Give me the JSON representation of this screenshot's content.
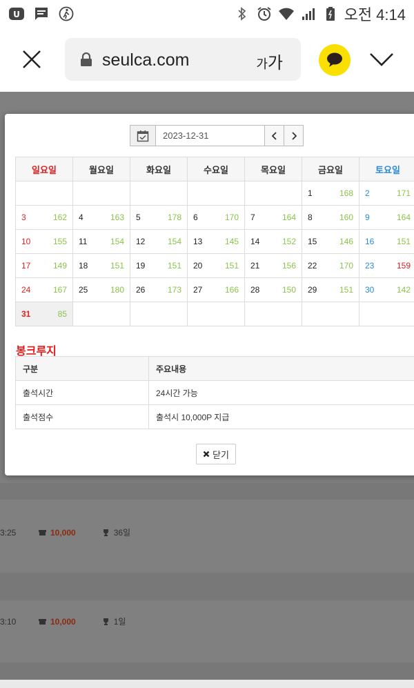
{
  "status_bar": {
    "time": "오전 4:14"
  },
  "browser": {
    "url": "seulca.com",
    "font_size_label_small": "가",
    "font_size_label_large": "가"
  },
  "calendar": {
    "date_value": "2023-12-31",
    "weekdays": [
      "일요일",
      "월요일",
      "화요일",
      "수요일",
      "목요일",
      "금요일",
      "토요일"
    ],
    "weeks": [
      [
        null,
        null,
        null,
        null,
        null,
        {
          "d": "1",
          "n": "168"
        },
        {
          "d": "2",
          "n": "171"
        }
      ],
      [
        {
          "d": "3",
          "n": "162"
        },
        {
          "d": "4",
          "n": "163"
        },
        {
          "d": "5",
          "n": "178"
        },
        {
          "d": "6",
          "n": "170"
        },
        {
          "d": "7",
          "n": "164"
        },
        {
          "d": "8",
          "n": "160"
        },
        {
          "d": "9",
          "n": "164"
        }
      ],
      [
        {
          "d": "10",
          "n": "155"
        },
        {
          "d": "11",
          "n": "154"
        },
        {
          "d": "12",
          "n": "154"
        },
        {
          "d": "13",
          "n": "145"
        },
        {
          "d": "14",
          "n": "152"
        },
        {
          "d": "15",
          "n": "146"
        },
        {
          "d": "16",
          "n": "151"
        }
      ],
      [
        {
          "d": "17",
          "n": "149"
        },
        {
          "d": "18",
          "n": "151"
        },
        {
          "d": "19",
          "n": "151"
        },
        {
          "d": "20",
          "n": "151"
        },
        {
          "d": "21",
          "n": "156"
        },
        {
          "d": "22",
          "n": "170"
        },
        {
          "d": "23",
          "n": "159"
        }
      ],
      [
        {
          "d": "24",
          "n": "167"
        },
        {
          "d": "25",
          "n": "180"
        },
        {
          "d": "26",
          "n": "173"
        },
        {
          "d": "27",
          "n": "166"
        },
        {
          "d": "28",
          "n": "150"
        },
        {
          "d": "29",
          "n": "151"
        },
        {
          "d": "30",
          "n": "142"
        }
      ],
      [
        {
          "d": "31",
          "n": "85"
        },
        null,
        null,
        null,
        null,
        null,
        null
      ]
    ]
  },
  "info": {
    "title": "봉크루지",
    "headers": [
      "구분",
      "주요내용"
    ],
    "rows": [
      [
        "출석시간",
        "24시간 가능"
      ],
      [
        "출석점수",
        "출석시 10,000P 지급"
      ]
    ]
  },
  "close_label": "닫기",
  "background_rows": [
    {
      "time": "3:25",
      "amount": "10,000",
      "days": "36일"
    },
    {
      "time": "3:10",
      "amount": "10,000",
      "days": "1일"
    }
  ],
  "colors": {
    "sunday": "#e02020",
    "saturday": "#2a8ad4",
    "count": "#8bc34a",
    "title": "#e41a1a",
    "kakao": "#f9e000"
  }
}
